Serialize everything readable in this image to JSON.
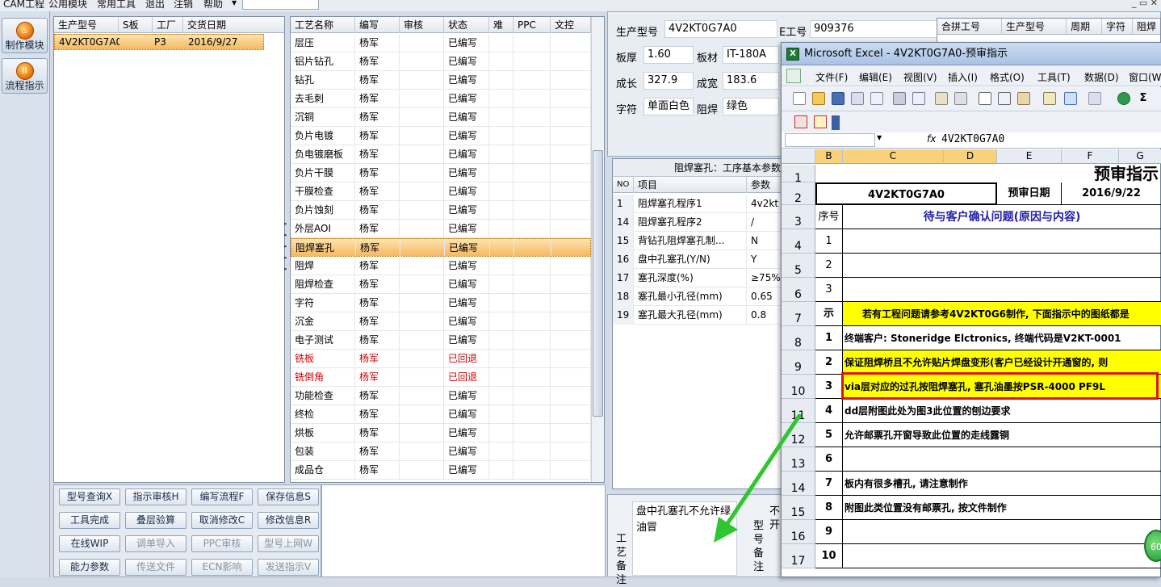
{
  "menubar": {
    "items": [
      "CAM工程",
      "公用模块",
      "常用工具",
      "退出",
      "注销",
      "帮助"
    ],
    "dropdown_arrow": "▼",
    "window_controls": "_ ▭ ✕"
  },
  "leftnav": {
    "items": [
      {
        "label": "制作模块",
        "icon": "flame-icon"
      },
      {
        "label": "流程指示",
        "icon": "pause-icon"
      }
    ]
  },
  "model_grid": {
    "columns": [
      "生产型号",
      "S板",
      "工厂",
      "交货日期"
    ],
    "rows": [
      {
        "model": "4V2KT0G7A0",
        "s": "",
        "factory": "P3",
        "date": "2016/9/27"
      }
    ]
  },
  "process_grid": {
    "columns": [
      "工艺名称",
      "编写",
      "审核",
      "状态",
      "难",
      "PPC",
      "文控"
    ],
    "rows": [
      {
        "name": "层压",
        "writer": "杨军",
        "status": "已编写"
      },
      {
        "name": "铝片钻孔",
        "writer": "杨军",
        "status": "已编写"
      },
      {
        "name": "钻孔",
        "writer": "杨军",
        "status": "已编写"
      },
      {
        "name": "去毛刺",
        "writer": "杨军",
        "status": "已编写"
      },
      {
        "name": "沉铜",
        "writer": "杨军",
        "status": "已编写"
      },
      {
        "name": "负片电镀",
        "writer": "杨军",
        "status": "已编写"
      },
      {
        "name": "负电镀磨板",
        "writer": "杨军",
        "status": "已编写"
      },
      {
        "name": "负片干膜",
        "writer": "杨军",
        "status": "已编写"
      },
      {
        "name": "干膜检查",
        "writer": "杨军",
        "status": "已编写"
      },
      {
        "name": "负片蚀刻",
        "writer": "杨军",
        "status": "已编写"
      },
      {
        "name": "外层AOI",
        "writer": "杨军",
        "status": "已编写"
      },
      {
        "name": "阻焊塞孔",
        "writer": "杨军",
        "status": "已编写",
        "selected": true
      },
      {
        "name": "阻焊",
        "writer": "杨军",
        "status": "已编写"
      },
      {
        "name": "阻焊检查",
        "writer": "杨军",
        "status": "已编写"
      },
      {
        "name": "字符",
        "writer": "杨军",
        "status": "已编写"
      },
      {
        "name": "沉金",
        "writer": "杨军",
        "status": "已编写"
      },
      {
        "name": "电子测试",
        "writer": "杨军",
        "status": "已编写"
      },
      {
        "name": "铣板",
        "writer": "杨军",
        "status": "已回退",
        "red": true
      },
      {
        "name": "铣倒角",
        "writer": "杨军",
        "status": "已回退",
        "red": true
      },
      {
        "name": "功能检查",
        "writer": "杨军",
        "status": "已编写"
      },
      {
        "name": "终检",
        "writer": "杨军",
        "status": "已编写"
      },
      {
        "name": "烘板",
        "writer": "杨军",
        "status": "已编写"
      },
      {
        "name": "包装",
        "writer": "杨军",
        "status": "已编写"
      },
      {
        "name": "成品仓",
        "writer": "杨军",
        "status": "已编写"
      }
    ]
  },
  "buttons": [
    {
      "label": "型号查询X",
      "enabled": true
    },
    {
      "label": "指示审核H",
      "enabled": true
    },
    {
      "label": "编写流程F",
      "enabled": true
    },
    {
      "label": "保存信息S",
      "enabled": true
    },
    {
      "label": "工具完成",
      "enabled": true
    },
    {
      "label": "叠层验算",
      "enabled": true
    },
    {
      "label": "取消修改C",
      "enabled": true
    },
    {
      "label": "修改信息R",
      "enabled": true
    },
    {
      "label": "在线WIP",
      "enabled": true
    },
    {
      "label": "调单导入",
      "enabled": false
    },
    {
      "label": "PPC审核",
      "enabled": false
    },
    {
      "label": "型号上网W",
      "enabled": false
    },
    {
      "label": "能力参数",
      "enabled": true
    },
    {
      "label": "传送文件",
      "enabled": false
    },
    {
      "label": "ECN影响",
      "enabled": false
    },
    {
      "label": "发送指示V",
      "enabled": false
    }
  ],
  "info": {
    "model_label": "生产型号",
    "model_value": "4V2KT0G7A0",
    "eno_label": "E工号",
    "eno_value": "909376",
    "thick_label": "板厚",
    "thick_value": "1.60",
    "mat_label": "板材",
    "mat_value": "IT-180A",
    "len_label": "成长",
    "len_value": "327.9",
    "wid_label": "成宽",
    "wid_value": "183.6",
    "char_label": "字符",
    "char_value": "单面白色",
    "mask_label": "阻焊",
    "mask_value": "绿色"
  },
  "merge_grid": {
    "columns": [
      "合拼工号",
      "生产型号",
      "周期",
      "字符",
      "阻焊"
    ]
  },
  "param_grid": {
    "title": "阻焊塞孔：工序基本参数",
    "columns": [
      "NO",
      "项目",
      "参数"
    ],
    "rows": [
      {
        "no": "1",
        "item": "阻焊塞孔程序1",
        "val": "4v2kt"
      },
      {
        "no": "14",
        "item": "阻焊塞孔程序2",
        "val": "/"
      },
      {
        "no": "15",
        "item": "背钻孔阻焊塞孔制...",
        "val": "N"
      },
      {
        "no": "16",
        "item": "盘中孔塞孔(Y/N)",
        "val": "Y"
      },
      {
        "no": "17",
        "item": "塞孔深度(%)",
        "val": "≥75%"
      },
      {
        "no": "18",
        "item": "塞孔最小孔径(mm)",
        "val": "0.65"
      },
      {
        "no": "19",
        "item": "塞孔最大孔径(mm)",
        "val": "0.8"
      }
    ]
  },
  "notes": {
    "label1": "工艺备注",
    "text": "盘中孔塞孔不允许绿油冒",
    "label2": "型号备注",
    "label3": "不开"
  },
  "excel": {
    "title": "Microsoft Excel - 4V2KT0G7A0-预审指示",
    "menu": [
      "文件(F)",
      "编辑(E)",
      "视图(V)",
      "插入(I)",
      "格式(O)",
      "工具(T)",
      "数据(D)",
      "窗口(W"
    ],
    "fx": "fx",
    "formula": "4V2KT0G7A0",
    "columns": [
      "B",
      "C",
      "D",
      "E",
      "F",
      "G"
    ],
    "row_nums": [
      "1",
      "2",
      "3",
      "4",
      "5",
      "6",
      "7",
      "8",
      "9",
      "10",
      "11",
      "12",
      "13",
      "14",
      "15",
      "16",
      "17"
    ],
    "header_title": "预审指示",
    "model": "4V2KT0G7A0",
    "review_date_label": "预审日期",
    "review_date": "2016/9/22",
    "seq_label": "序号",
    "confirm_label": "待与客户确认问题(原因与内容)",
    "row7_left": "示",
    "row7_text": "若有工程问题请参考4V2KT0G6制作, 下面指示中的图纸都是",
    "items": [
      {
        "n": "1",
        "text": ""
      },
      {
        "n": "2",
        "text": ""
      },
      {
        "n": "3",
        "text": ""
      },
      {
        "n": "1",
        "text": "终端客户: Stoneridge Elctronics, 终端代码是V2KT-0001"
      },
      {
        "n": "2",
        "text": "保证阻焊桥且不允许贴片焊盘变形(客户已经设计开通窗的, 则"
      },
      {
        "n": "3",
        "text": "via层对应的过孔按阻焊塞孔, 塞孔油墨按PSR-4000 PF9L"
      },
      {
        "n": "4",
        "text": "dd层附图此处为图3此位置的刨边要求"
      },
      {
        "n": "5",
        "text": "允许邮票孔开窗导致此位置的走线露铜"
      },
      {
        "n": "6",
        "text": ""
      },
      {
        "n": "7",
        "text": "板内有很多槽孔, 请注意制作"
      },
      {
        "n": "8",
        "text": "附图此类位置没有邮票孔, 按文件制作"
      },
      {
        "n": "9",
        "text": ""
      },
      {
        "n": "10",
        "text": ""
      }
    ]
  },
  "badge": "60"
}
